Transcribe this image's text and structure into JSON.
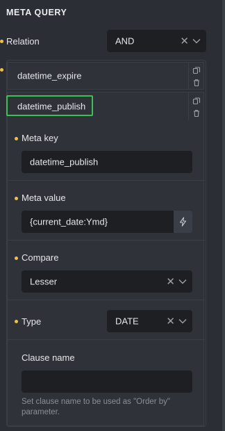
{
  "panel": {
    "title": "META QUERY",
    "relation": {
      "label": "Relation",
      "value": "AND"
    }
  },
  "items": [
    {
      "title": "datetime_expire"
    },
    {
      "title": "datetime_publish"
    }
  ],
  "fields": {
    "meta_key": {
      "label": "Meta key",
      "value": "datetime_publish"
    },
    "meta_value": {
      "label": "Meta value",
      "value": "{current_date:Ymd}"
    },
    "compare": {
      "label": "Compare",
      "value": "Lesser"
    },
    "type": {
      "label": "Type",
      "value": "DATE"
    },
    "clause_name": {
      "label": "Clause name",
      "value": "",
      "hint": "Set clause name to be used as \"Order by\" parameter."
    }
  },
  "icons": {
    "clone": "clone-icon",
    "delete": "trash-icon",
    "clear": "close-icon",
    "dropdown": "chevron-down-icon",
    "dynamic_data": "bolt-icon"
  },
  "colors": {
    "background": "#2b2e34",
    "input": "#1d1f23",
    "accent_dot": "#f0c23e",
    "highlight": "#39c152"
  }
}
